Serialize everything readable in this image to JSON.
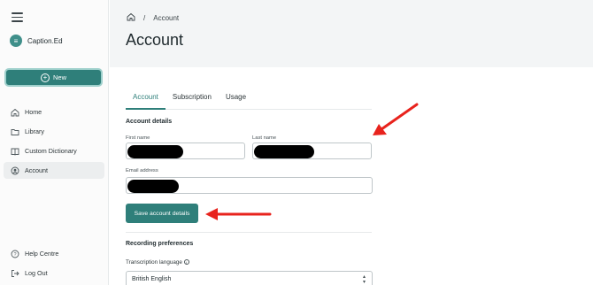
{
  "brand": {
    "name": "Caption.Ed",
    "logo_glyph": "≡"
  },
  "sidebar": {
    "new_label": "New",
    "items": [
      {
        "label": "Home",
        "icon": "home-icon"
      },
      {
        "label": "Library",
        "icon": "folder-icon"
      },
      {
        "label": "Custom Dictionary",
        "icon": "book-icon"
      },
      {
        "label": "Account",
        "icon": "account-icon",
        "active": true
      }
    ],
    "bottom_items": [
      {
        "label": "Help Centre",
        "icon": "help-icon"
      },
      {
        "label": "Log Out",
        "icon": "logout-icon"
      }
    ]
  },
  "breadcrumb": {
    "separator": "/",
    "current": "Account"
  },
  "page": {
    "title": "Account"
  },
  "tabs": [
    {
      "label": "Account",
      "active": true
    },
    {
      "label": "Subscription"
    },
    {
      "label": "Usage"
    }
  ],
  "account_details": {
    "title": "Account details",
    "first_name_label": "First name",
    "last_name_label": "Last name",
    "email_label": "Email address",
    "save_label": "Save account details"
  },
  "recording": {
    "title": "Recording preferences",
    "language_label": "Transcription language",
    "language_value": "British English"
  },
  "colors": {
    "accent": "#2f7f7a",
    "annotation_arrow": "#e8231d"
  }
}
